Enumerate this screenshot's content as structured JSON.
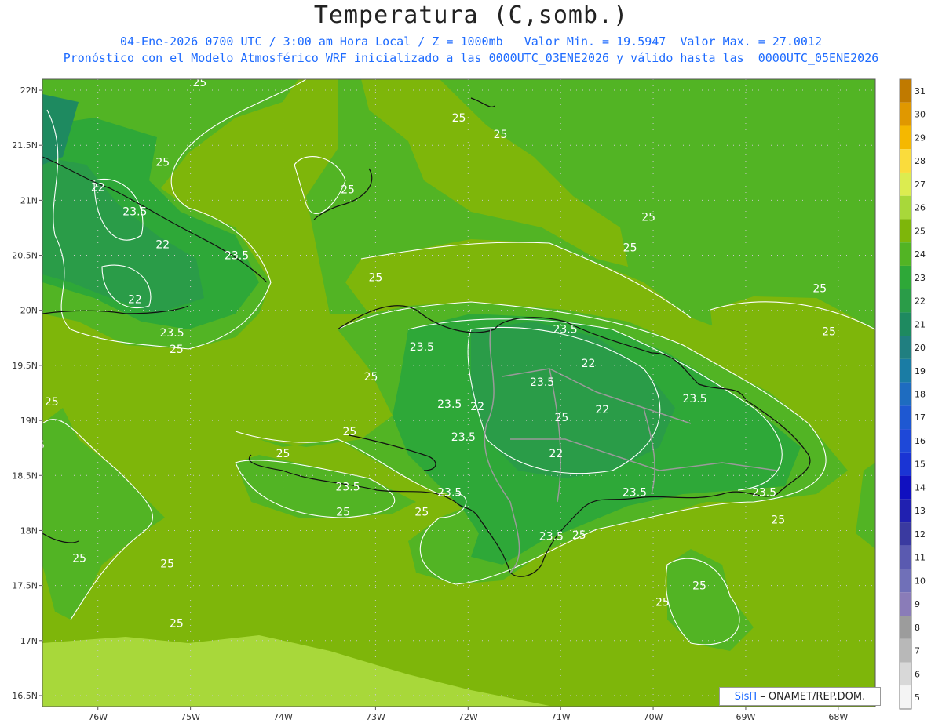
{
  "title": "Temperatura (C,somb.)",
  "subtitle_line1": "04-Ene-2026 0700 UTC / 3:00 am Hora Local / Z = 1000mb   Valor Min. = 19.5947  Valor Max. = 27.0012",
  "subtitle_line2": "Pronóstico con el Modelo Atmosférico WRF inicializado a las 0000UTC_03ENE2026 y válido hasta las  0000UTC_05ENE2026",
  "credit": {
    "brand": "SisΠ",
    "org": "– ONAMET/REP.DOM."
  },
  "axes": {
    "lat_labels": [
      "22N",
      "21.5N",
      "21N",
      "20.5N",
      "20N",
      "19.5N",
      "19N",
      "18.5N",
      "18N",
      "17.5N",
      "17N",
      "16.5N"
    ],
    "lon_labels": [
      "76W",
      "75W",
      "74W",
      "73W",
      "72W",
      "71W",
      "70W",
      "69W",
      "68W"
    ]
  },
  "colorbar": {
    "labels": [
      "31",
      "30",
      "29",
      "28",
      "27",
      "26",
      "25",
      "24",
      "23",
      "22",
      "21",
      "20",
      "19",
      "18",
      "17",
      "16",
      "15",
      "14",
      "13",
      "12",
      "11",
      "10",
      "9",
      "8",
      "7",
      "6",
      "5"
    ],
    "colors": [
      "#c07a00",
      "#e09800",
      "#f5b800",
      "#fadc3c",
      "#dcec50",
      "#a8d83a",
      "#7eb60a",
      "#52b424",
      "#2ea838",
      "#2a9c48",
      "#1e8a60",
      "#207f80",
      "#1a7ca4",
      "#1e6cc0",
      "#1e58d2",
      "#1e48d8",
      "#1a34d4",
      "#1010c0",
      "#2020b0",
      "#3a3aa0",
      "#5a5ab0",
      "#7070b8",
      "#8a7cb8",
      "#9c9c9c",
      "#b8b8b8",
      "#d8d8d8",
      "#f4f4f4"
    ]
  },
  "contour_labels": [
    {
      "text": "25",
      "lat": 22.07,
      "lon": -74.9
    },
    {
      "text": "25",
      "lat": 21.75,
      "lon": -72.1
    },
    {
      "text": "25",
      "lat": 21.6,
      "lon": -71.65
    },
    {
      "text": "25",
      "lat": 21.35,
      "lon": -75.3
    },
    {
      "text": "22",
      "lat": 21.12,
      "lon": -76.0
    },
    {
      "text": "25",
      "lat": 21.1,
      "lon": -73.3
    },
    {
      "text": "23.5",
      "lat": 20.9,
      "lon": -75.6
    },
    {
      "text": "25",
      "lat": 20.85,
      "lon": -70.05
    },
    {
      "text": "22",
      "lat": 20.6,
      "lon": -75.3
    },
    {
      "text": "23.5",
      "lat": 20.5,
      "lon": -74.5
    },
    {
      "text": "25",
      "lat": 20.57,
      "lon": -70.25
    },
    {
      "text": "25",
      "lat": 20.3,
      "lon": -73.0
    },
    {
      "text": "25",
      "lat": 20.2,
      "lon": -68.2
    },
    {
      "text": "22",
      "lat": 20.1,
      "lon": -75.6
    },
    {
      "text": "23.5",
      "lat": 19.8,
      "lon": -75.2
    },
    {
      "text": "23.5",
      "lat": 19.83,
      "lon": -70.95
    },
    {
      "text": "25",
      "lat": 19.81,
      "lon": -68.1
    },
    {
      "text": "23.5",
      "lat": 19.67,
      "lon": -72.5
    },
    {
      "text": "25",
      "lat": 19.65,
      "lon": -75.15
    },
    {
      "text": "22",
      "lat": 19.52,
      "lon": -70.7
    },
    {
      "text": "25",
      "lat": 19.4,
      "lon": -73.05
    },
    {
      "text": "23.5",
      "lat": 19.35,
      "lon": -71.2
    },
    {
      "text": "23.5",
      "lat": 19.2,
      "lon": -69.55
    },
    {
      "text": "25",
      "lat": 19.17,
      "lon": -76.5
    },
    {
      "text": "23.5",
      "lat": 19.15,
      "lon": -72.2
    },
    {
      "text": "22",
      "lat": 19.13,
      "lon": -71.9
    },
    {
      "text": "22",
      "lat": 19.1,
      "lon": -70.55
    },
    {
      "text": "25",
      "lat": 19.03,
      "lon": -70.99
    },
    {
      "text": "25",
      "lat": 18.9,
      "lon": -73.28
    },
    {
      "text": "23.5",
      "lat": 18.85,
      "lon": -72.05
    },
    {
      "text": "25",
      "lat": 18.78,
      "lon": -76.65
    },
    {
      "text": "25",
      "lat": 18.7,
      "lon": -74.0
    },
    {
      "text": "22",
      "lat": 18.7,
      "lon": -71.05
    },
    {
      "text": "23.5",
      "lat": 18.4,
      "lon": -73.3
    },
    {
      "text": "23.5",
      "lat": 18.35,
      "lon": -72.2
    },
    {
      "text": "23.5",
      "lat": 18.35,
      "lon": -70.2
    },
    {
      "text": "23.5",
      "lat": 18.35,
      "lon": -68.8
    },
    {
      "text": "25",
      "lat": 18.17,
      "lon": -73.35
    },
    {
      "text": "25",
      "lat": 18.17,
      "lon": -72.5
    },
    {
      "text": "25",
      "lat": 18.1,
      "lon": -68.65
    },
    {
      "text": "23.5",
      "lat": 17.95,
      "lon": -71.1
    },
    {
      "text": "25",
      "lat": 17.96,
      "lon": -70.8
    },
    {
      "text": "25",
      "lat": 17.75,
      "lon": -76.2
    },
    {
      "text": "25",
      "lat": 17.7,
      "lon": -75.25
    },
    {
      "text": "25",
      "lat": 17.5,
      "lon": -69.5
    },
    {
      "text": "25",
      "lat": 17.35,
      "lon": -69.9
    },
    {
      "text": "25",
      "lat": 17.16,
      "lon": -75.15
    }
  ]
}
